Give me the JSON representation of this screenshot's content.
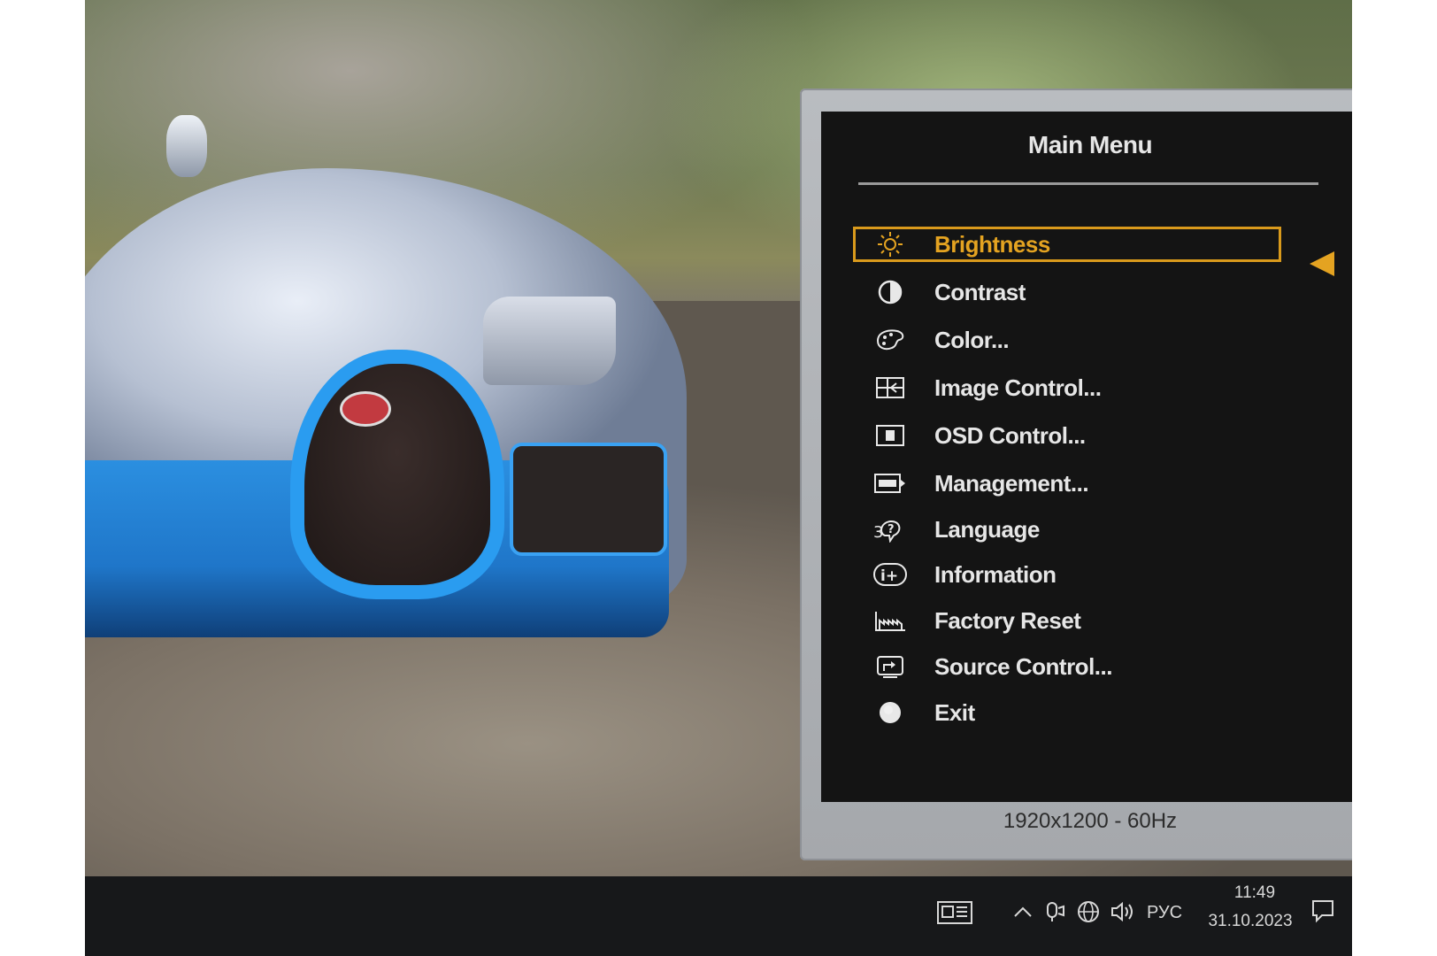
{
  "osd": {
    "title": "Main Menu",
    "resolution": "1920x1200 - 60Hz",
    "accent_color": "#e4a321",
    "selected_index": 0,
    "items": [
      {
        "label": "Brightness",
        "icon": "brightness-sun-icon"
      },
      {
        "label": "Contrast",
        "icon": "contrast-half-circle-icon"
      },
      {
        "label": "Color...",
        "icon": "color-palette-icon"
      },
      {
        "label": "Image Control...",
        "icon": "image-control-icon"
      },
      {
        "label": "OSD Control...",
        "icon": "osd-control-icon"
      },
      {
        "label": "Management...",
        "icon": "management-icon"
      },
      {
        "label": "Language",
        "icon": "language-icon"
      },
      {
        "label": "Information",
        "icon": "information-icon"
      },
      {
        "label": "Factory Reset",
        "icon": "factory-reset-icon"
      },
      {
        "label": "Source Control...",
        "icon": "source-control-icon"
      },
      {
        "label": "Exit",
        "icon": "exit-circle-icon"
      }
    ]
  },
  "taskbar": {
    "language": "РУС",
    "time": "11:49",
    "date": "31.10.2023"
  }
}
